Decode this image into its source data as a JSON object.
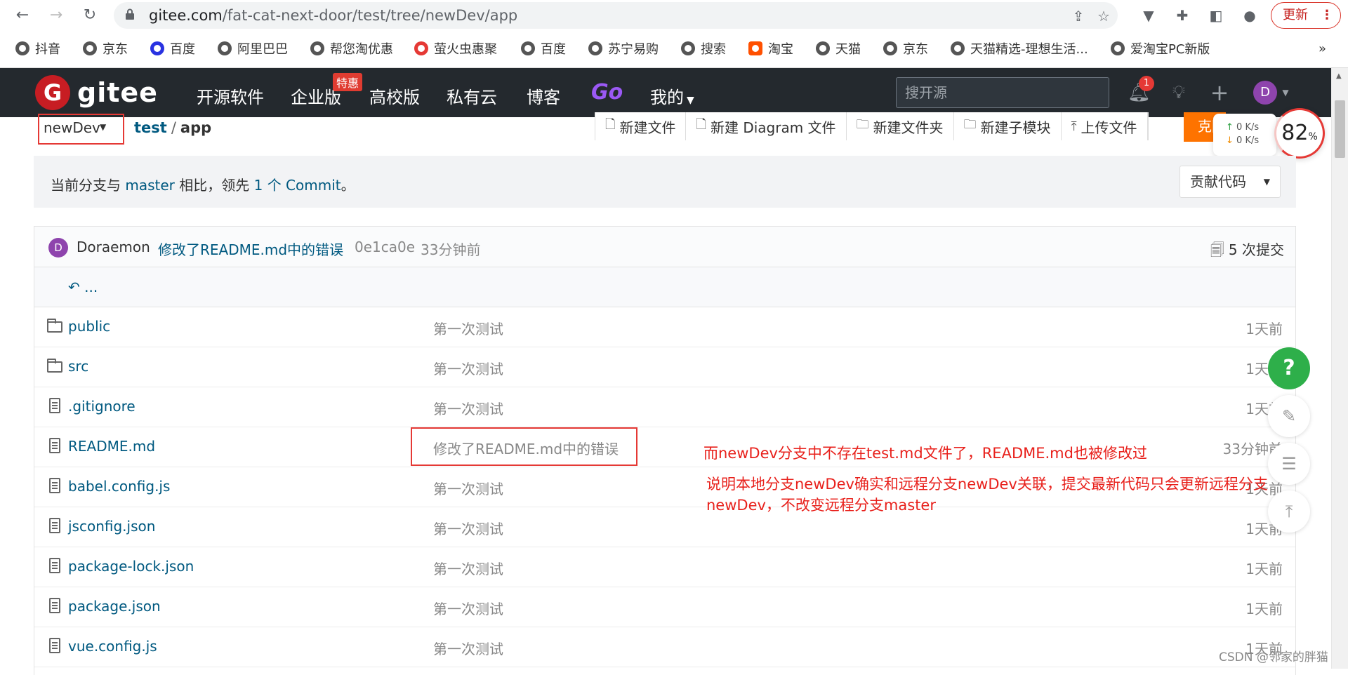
{
  "browser": {
    "url_host": "gitee.com",
    "url_path": "/fat-cat-next-door/test/tree/newDev/app",
    "update_label": "更新",
    "bookmarks": [
      "抖音",
      "京东",
      "百度",
      "阿里巴巴",
      "帮您淘优惠",
      "萤火虫惠聚",
      "百度",
      "苏宁易购",
      "搜索",
      "淘宝",
      "天猫",
      "京东",
      "天猫精选-理想生活...",
      "爱淘宝PC新版"
    ],
    "bookmarks_more": "»"
  },
  "gitee": {
    "logo_text": "gitee",
    "nav": [
      "开源软件",
      "企业版",
      "高校版",
      "私有云",
      "博客",
      "Go",
      "我的"
    ],
    "enterprise_badge": "特惠",
    "search_placeholder": "搜开源",
    "notification_count": "1",
    "avatar_letter": "D"
  },
  "repo": {
    "branch": "newDev",
    "breadcrumb": [
      "test",
      "app"
    ],
    "actions": [
      "新建文件",
      "新建 Diagram 文件",
      "新建文件夹",
      "新建子模块",
      "上传文件"
    ],
    "clone_label": "克隆",
    "net_speed": {
      "up": "0 K/s",
      "down": "0 K/s"
    },
    "perf_score": "82",
    "perf_unit": "%",
    "compare": {
      "prefix": "当前分支与 ",
      "base": "master",
      "middle": " 相比，领先 ",
      "count": "1 个 Commit",
      "suffix": "。"
    },
    "contribute_label": "贡献代码",
    "last_commit": {
      "avatar": "D",
      "author": "Doraemon",
      "message": "修改了README.md中的错误",
      "hash": "0e1ca0e",
      "time": "33分钟前",
      "count": "5 次提交"
    },
    "back_label": "...",
    "files": [
      {
        "type": "folder",
        "name": "public",
        "message": "第一次测试",
        "time": "1天前"
      },
      {
        "type": "folder",
        "name": "src",
        "message": "第一次测试",
        "time": "1天前"
      },
      {
        "type": "file",
        "name": ".gitignore",
        "message": "第一次测试",
        "time": "1天前"
      },
      {
        "type": "file",
        "name": "README.md",
        "message": "修改了README.md中的错误",
        "time": "33分钟前"
      },
      {
        "type": "file",
        "name": "babel.config.js",
        "message": "第一次测试",
        "time": "1天前"
      },
      {
        "type": "file",
        "name": "jsconfig.json",
        "message": "第一次测试",
        "time": "1天前"
      },
      {
        "type": "file",
        "name": "package-lock.json",
        "message": "第一次测试",
        "time": "1天前"
      },
      {
        "type": "file",
        "name": "package.json",
        "message": "第一次测试",
        "time": "1天前"
      },
      {
        "type": "file",
        "name": "vue.config.js",
        "message": "第一次测试",
        "time": "1天前"
      }
    ]
  },
  "annotations": {
    "line1": "而newDev分支中不存在test.md文件了，README.md也被修改过",
    "line2": "说明本地分支newDev确实和远程分支newDev关联，提交最新代码只会更新远程分支",
    "line3": "newDev，不改变远程分支master"
  },
  "float": {
    "help": "?"
  },
  "watermark": "CSDN @邻家的胖猫"
}
